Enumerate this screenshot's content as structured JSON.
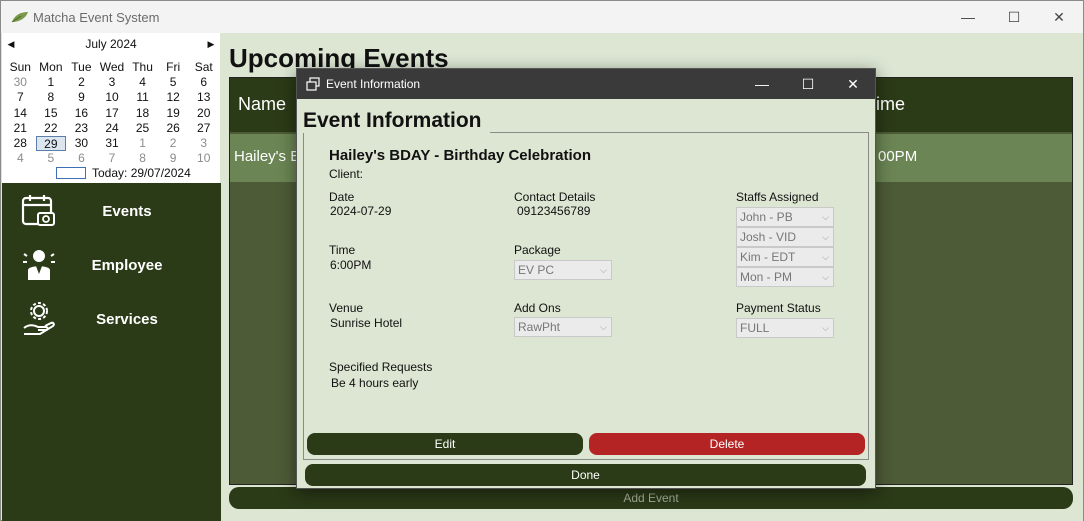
{
  "window": {
    "title": "Matcha Event System",
    "minimize": "—",
    "maximize": "☐",
    "close": "✕"
  },
  "calendar": {
    "month_label": "July 2024",
    "prev": "◀",
    "next": "▶",
    "weekdays": [
      "Sun",
      "Mon",
      "Tue",
      "Wed",
      "Thu",
      "Fri",
      "Sat"
    ],
    "days": [
      {
        "d": "30",
        "other": true
      },
      {
        "d": "1"
      },
      {
        "d": "2"
      },
      {
        "d": "3"
      },
      {
        "d": "4"
      },
      {
        "d": "5"
      },
      {
        "d": "6"
      },
      {
        "d": "7"
      },
      {
        "d": "8"
      },
      {
        "d": "9"
      },
      {
        "d": "10"
      },
      {
        "d": "11"
      },
      {
        "d": "12"
      },
      {
        "d": "13"
      },
      {
        "d": "14"
      },
      {
        "d": "15"
      },
      {
        "d": "16"
      },
      {
        "d": "17"
      },
      {
        "d": "18"
      },
      {
        "d": "19"
      },
      {
        "d": "20"
      },
      {
        "d": "21"
      },
      {
        "d": "22"
      },
      {
        "d": "23"
      },
      {
        "d": "24"
      },
      {
        "d": "25"
      },
      {
        "d": "26"
      },
      {
        "d": "27"
      },
      {
        "d": "28"
      },
      {
        "d": "29",
        "selected": true
      },
      {
        "d": "30"
      },
      {
        "d": "31"
      },
      {
        "d": "1",
        "other": true
      },
      {
        "d": "2",
        "other": true
      },
      {
        "d": "3",
        "other": true
      },
      {
        "d": "4",
        "other": true
      },
      {
        "d": "5",
        "other": true
      },
      {
        "d": "6",
        "other": true
      },
      {
        "d": "7",
        "other": true
      },
      {
        "d": "8",
        "other": true
      },
      {
        "d": "9",
        "other": true
      },
      {
        "d": "10",
        "other": true
      }
    ],
    "today_label": "Today: 29/07/2024"
  },
  "sidebar": {
    "items": [
      {
        "label": "Events",
        "icon": "calendar-camera-icon"
      },
      {
        "label": "Employee",
        "icon": "employee-icon"
      },
      {
        "label": "Services",
        "icon": "services-icon"
      }
    ]
  },
  "main": {
    "title": "Upcoming Events",
    "columns": {
      "name": "Name",
      "time": "ime"
    },
    "rows": [
      {
        "name": "Hailey's B",
        "time": "00PM"
      }
    ],
    "add_button": "Add Event"
  },
  "dialog": {
    "title": "Event Information",
    "group_title": "Event Information",
    "event_name": "Hailey's BDAY - Birthday Celebration",
    "client_label": "Client:",
    "date_label": "Date",
    "date_value": "2024-07-29",
    "contact_label": "Contact Details",
    "contact_value": "09123456789",
    "staffs_label": "Staffs Assigned",
    "staffs": [
      "John - PB",
      "Josh - VID",
      "Kim - EDT",
      "Mon - PM"
    ],
    "time_label": "Time",
    "time_value": "6:00PM",
    "package_label": "Package",
    "package_value": "EV PC",
    "venue_label": "Venue",
    "venue_value": "Sunrise Hotel",
    "addons_label": "Add Ons",
    "addons_value": "RawPht",
    "payment_label": "Payment Status",
    "payment_value": "FULL",
    "requests_label": "Specified Requests",
    "requests_value": "Be 4 hours early",
    "edit_button": "Edit",
    "delete_button": "Delete",
    "done_button": "Done"
  },
  "colors": {
    "dark_green": "#2b3a17",
    "light_green_bg": "#dce6d3",
    "row_green": "#6b8554",
    "delete_red": "#b52424"
  }
}
